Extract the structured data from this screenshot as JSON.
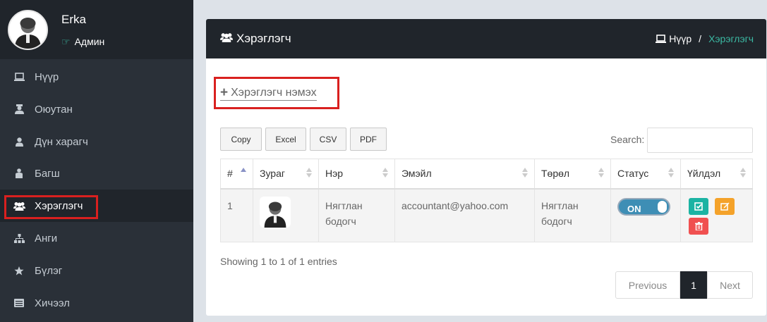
{
  "profile": {
    "name": "Erka",
    "role": "Админ"
  },
  "sidebar": {
    "items": [
      {
        "label": "Нүүр",
        "icon": "laptop-icon"
      },
      {
        "label": "Оюутан",
        "icon": "student-icon"
      },
      {
        "label": "Дүн харагч",
        "icon": "user-icon"
      },
      {
        "label": "Багш",
        "icon": "teacher-icon"
      },
      {
        "label": "Хэрэглэгч",
        "icon": "users-icon",
        "active": true
      },
      {
        "label": "Анги",
        "icon": "sitemap-icon"
      },
      {
        "label": "Бүлэг",
        "icon": "star-icon"
      },
      {
        "label": "Хичээл",
        "icon": "book-icon"
      }
    ]
  },
  "panel": {
    "title": "Хэрэглэгч",
    "breadcrumb": {
      "home": "Нүүр",
      "separator": "/",
      "current": "Хэрэглэгч"
    },
    "add_label": "Хэрэглэгч нэмэх"
  },
  "toolbar": {
    "copy": "Copy",
    "excel": "Excel",
    "csv": "CSV",
    "pdf": "PDF",
    "search_label": "Search:",
    "search_value": ""
  },
  "table": {
    "headers": [
      "#",
      "Зураг",
      "Нэр",
      "Эмэйл",
      "Төрөл",
      "Статус",
      "Үйлдэл"
    ],
    "rows": [
      {
        "num": "1",
        "name": "Нягтлан бодогч",
        "email": "accountant@yahoo.com",
        "type": "Нягтлан бодогч",
        "status": "ON"
      }
    ]
  },
  "footer": {
    "info": "Showing 1 to 1 of 1 entries",
    "previous": "Previous",
    "page": "1",
    "next": "Next"
  },
  "colors": {
    "sidebar": "#2a3038",
    "header": "#20252b",
    "accent": "#3bb9a3",
    "highlight": "#d9201f",
    "toggle": "#3e8eb5",
    "check": "#1bb3a3",
    "edit": "#f4a22a",
    "delete": "#f05050"
  }
}
